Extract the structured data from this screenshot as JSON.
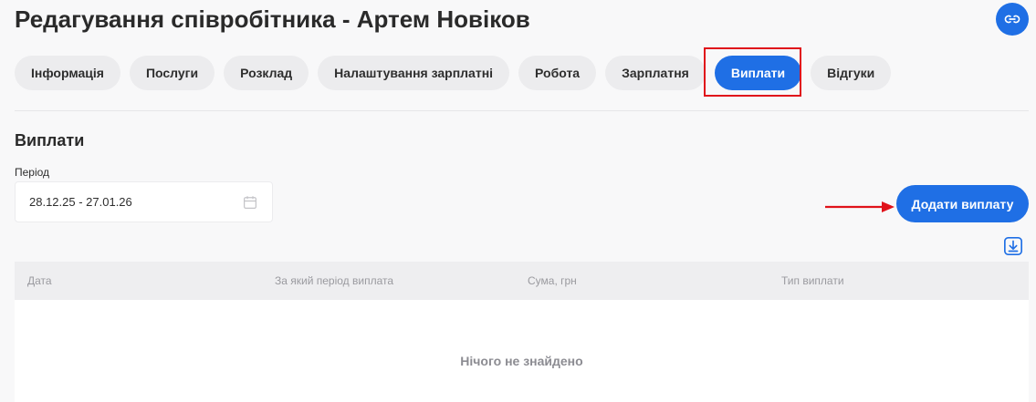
{
  "header": {
    "title": "Редагування співробітника - Артем Новіков",
    "link_icon": "link-icon"
  },
  "tabs": [
    {
      "label": "Інформація",
      "active": false
    },
    {
      "label": "Послуги",
      "active": false
    },
    {
      "label": "Розклад",
      "active": false
    },
    {
      "label": "Налаштування зарплатні",
      "active": false
    },
    {
      "label": "Робота",
      "active": false
    },
    {
      "label": "Зарплатня",
      "active": false
    },
    {
      "label": "Виплати",
      "active": true
    },
    {
      "label": "Відгуки",
      "active": false
    }
  ],
  "section": {
    "title": "Виплати",
    "period_label": "Період",
    "period_value": "28.12.25 - 27.01.26",
    "add_button": "Додати виплату"
  },
  "table": {
    "columns": [
      "Дата",
      "За який період виплата",
      "Сума, грн",
      "Тип виплати"
    ],
    "empty_text": "Нічого не знайдено"
  },
  "colors": {
    "accent": "#1f6fe5",
    "highlight": "#e0121a"
  }
}
